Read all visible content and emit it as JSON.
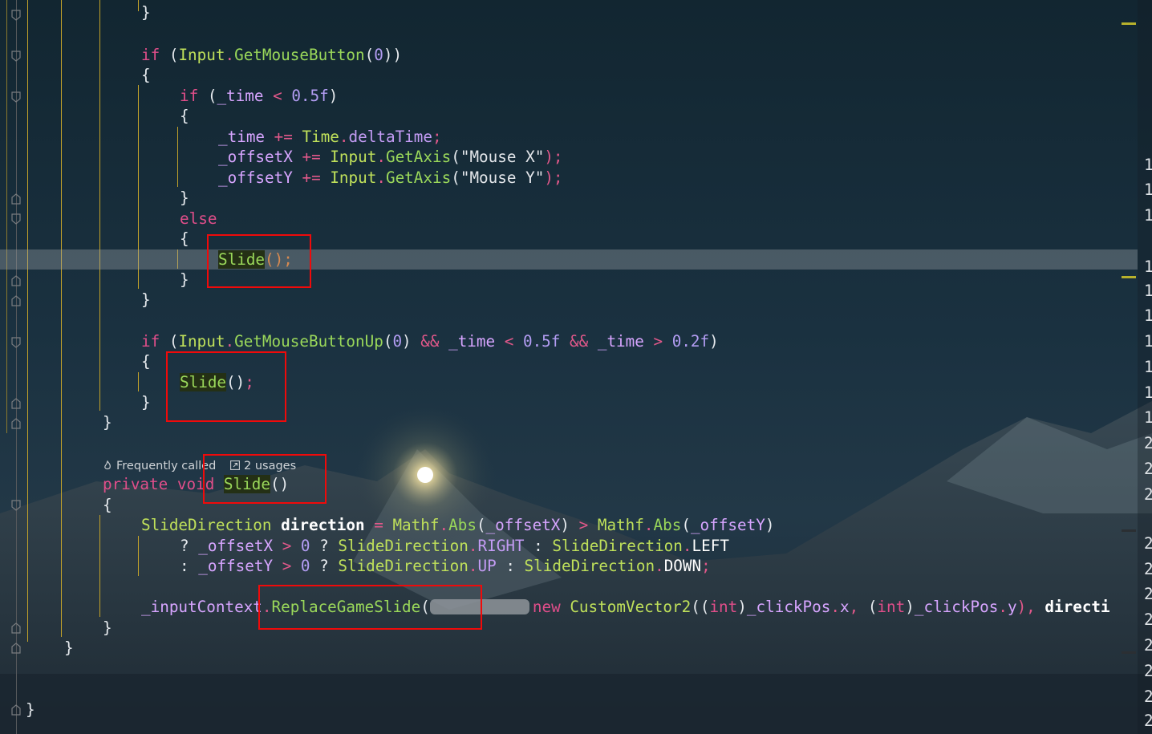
{
  "editor": {
    "lines": [
      {
        "t": 3,
        "segs": [
          [
            "}",
            "pn"
          ]
        ]
      },
      {
        "t": 56,
        "segs": [
          [
            "if ",
            "kw"
          ],
          [
            "(",
            "pn"
          ],
          [
            "Input",
            "ty"
          ],
          [
            ".",
            "op"
          ],
          [
            "GetMouseButton",
            "fn"
          ],
          [
            "(",
            "pn"
          ],
          [
            "0",
            "num"
          ],
          [
            "))",
            "pn"
          ]
        ]
      },
      {
        "t": 81,
        "segs": [
          [
            "{",
            "pn"
          ]
        ]
      },
      {
        "t": 107,
        "segs": [
          [
            "if ",
            "kw"
          ],
          [
            "(",
            "pn"
          ],
          [
            "_time",
            "fld"
          ],
          [
            " < ",
            "op"
          ],
          [
            "0.5f",
            "num"
          ],
          [
            ")",
            "pn"
          ]
        ]
      },
      {
        "t": 132,
        "segs": [
          [
            "{",
            "pn"
          ]
        ]
      },
      {
        "t": 158,
        "segs": [
          [
            "_time",
            "fld"
          ],
          [
            " += ",
            "op"
          ],
          [
            "Time",
            "ty"
          ],
          [
            ".",
            "op"
          ],
          [
            "deltaTime",
            "hf"
          ],
          [
            ";",
            "semi"
          ]
        ]
      },
      {
        "t": 183,
        "segs": [
          [
            "_offsetX",
            "fld"
          ],
          [
            " += ",
            "op"
          ],
          [
            "Input",
            "ty"
          ],
          [
            ".",
            "op"
          ],
          [
            "GetAxis",
            "fn"
          ],
          [
            "(",
            "pn"
          ],
          [
            "\"Mouse X\"",
            "str"
          ],
          [
            ");",
            "semi"
          ]
        ]
      },
      {
        "t": 209,
        "segs": [
          [
            "_offsetY",
            "fld"
          ],
          [
            " += ",
            "op"
          ],
          [
            "Input",
            "ty"
          ],
          [
            ".",
            "op"
          ],
          [
            "GetAxis",
            "fn"
          ],
          [
            "(",
            "pn"
          ],
          [
            "\"Mouse Y\"",
            "str"
          ],
          [
            ");",
            "semi"
          ]
        ]
      },
      {
        "t": 234,
        "segs": [
          [
            "}",
            "pn"
          ]
        ]
      },
      {
        "t": 260,
        "segs": [
          [
            "else",
            "kw"
          ]
        ]
      },
      {
        "t": 285,
        "segs": [
          [
            "{",
            "pn"
          ]
        ]
      },
      {
        "t": 311,
        "segs": [
          [
            "Slide",
            "fn usage-hl"
          ],
          [
            "()",
            "o"
          ],
          [
            ";",
            "o"
          ]
        ]
      },
      {
        "t": 336,
        "segs": [
          [
            "}",
            "pn"
          ]
        ]
      },
      {
        "t": 361,
        "segs": [
          [
            "}",
            "pn"
          ]
        ]
      },
      {
        "t": 413,
        "segs": [
          [
            "if ",
            "kw"
          ],
          [
            "(",
            "pn"
          ],
          [
            "Input",
            "ty"
          ],
          [
            ".",
            "op"
          ],
          [
            "GetMouseButtonUp",
            "fn"
          ],
          [
            "(",
            "pn"
          ],
          [
            "0",
            "num"
          ],
          [
            ") ",
            "pn"
          ],
          [
            "&& ",
            "op"
          ],
          [
            "_time",
            "fld"
          ],
          [
            " < ",
            "op"
          ],
          [
            "0.5f",
            "num"
          ],
          [
            " && ",
            "op"
          ],
          [
            "_time",
            "fld"
          ],
          [
            " > ",
            "op"
          ],
          [
            "0.2f",
            "num"
          ],
          [
            ")",
            "pn"
          ]
        ]
      },
      {
        "t": 438,
        "segs": [
          [
            "{",
            "pn"
          ]
        ]
      },
      {
        "t": 464,
        "segs": [
          [
            "Slide",
            "fn usage-hl"
          ],
          [
            "()",
            "pn"
          ],
          [
            ";",
            "semi"
          ]
        ]
      },
      {
        "t": 489,
        "segs": [
          [
            "}",
            "pn"
          ]
        ]
      },
      {
        "t": 514,
        "segs": [
          [
            "}",
            "pn"
          ]
        ]
      },
      {
        "t": 591,
        "segs": [
          [
            "private ",
            "kw"
          ],
          [
            "void ",
            "kw"
          ],
          [
            "Slide",
            "fn usage-hl"
          ],
          [
            "()",
            "pn"
          ]
        ]
      },
      {
        "t": 617,
        "segs": [
          [
            "{",
            "pn"
          ]
        ]
      },
      {
        "t": 642,
        "segs": [
          [
            "SlideDirection",
            "ty"
          ],
          [
            " ",
            "pn"
          ],
          [
            "direction",
            "lc"
          ],
          [
            " = ",
            "op"
          ],
          [
            "Mathf",
            "ty"
          ],
          [
            ".",
            "op"
          ],
          [
            "Abs",
            "fn"
          ],
          [
            "(",
            "pn"
          ],
          [
            "_offsetX",
            "fld"
          ],
          [
            ") ",
            "pn"
          ],
          [
            "> ",
            "op"
          ],
          [
            "Mathf",
            "ty"
          ],
          [
            ".",
            "op"
          ],
          [
            "Abs",
            "fn"
          ],
          [
            "(",
            "pn"
          ],
          [
            "_offsetY",
            "fld"
          ],
          [
            ")",
            "pn"
          ]
        ]
      },
      {
        "t": 668,
        "segs": [
          [
            "? ",
            "pn"
          ],
          [
            "_offsetX",
            "fld"
          ],
          [
            " > ",
            "op"
          ],
          [
            "0",
            "num"
          ],
          [
            " ? ",
            "pn"
          ],
          [
            "SlideDirection",
            "ty"
          ],
          [
            ".",
            "op"
          ],
          [
            "RIGHT",
            "hf"
          ],
          [
            " : ",
            "pn"
          ],
          [
            "SlideDirection",
            "ty"
          ],
          [
            ".",
            "op"
          ],
          [
            "LEFT",
            "pl"
          ]
        ]
      },
      {
        "t": 693,
        "segs": [
          [
            ": ",
            "pn"
          ],
          [
            "_offsetY",
            "fld"
          ],
          [
            " > ",
            "op"
          ],
          [
            "0",
            "num"
          ],
          [
            " ? ",
            "pn"
          ],
          [
            "SlideDirection",
            "ty"
          ],
          [
            ".",
            "op"
          ],
          [
            "UP",
            "hf"
          ],
          [
            " : ",
            "pn"
          ],
          [
            "SlideDirection",
            "ty"
          ],
          [
            ".",
            "op"
          ],
          [
            "DOWN",
            "pl"
          ],
          [
            ";",
            "semi"
          ]
        ]
      },
      {
        "t": 744,
        "segs": [
          [
            "_inputContext",
            "fld"
          ],
          [
            ".",
            "op"
          ],
          [
            "ReplaceGameSlide",
            "fn"
          ],
          [
            "(",
            "pn"
          ],
          [
            "BLUR",
            "blur"
          ],
          [
            "new ",
            "kw"
          ],
          [
            "CustomVector2",
            "ty"
          ],
          [
            "((",
            "pn"
          ],
          [
            "int",
            "kw"
          ],
          [
            ")",
            "pn"
          ],
          [
            "_clickPos",
            "fld"
          ],
          [
            ".",
            "op"
          ],
          [
            "x",
            "fld"
          ],
          [
            ", ",
            "op"
          ],
          [
            "(",
            "pn"
          ],
          [
            "int",
            "kw"
          ],
          [
            ")",
            "pn"
          ],
          [
            "_clickPos",
            "fld"
          ],
          [
            ".",
            "op"
          ],
          [
            "y",
            "fld"
          ],
          [
            "), ",
            "op"
          ],
          [
            "directi",
            "lc"
          ]
        ]
      },
      {
        "t": 770,
        "segs": [
          [
            "}",
            "pn"
          ]
        ]
      },
      {
        "t": 795,
        "segs": [
          [
            "}",
            "pn"
          ]
        ]
      },
      {
        "t": 872,
        "segs": [
          [
            "}",
            "pn"
          ]
        ]
      }
    ],
    "inlay_hint": {
      "frequently_called": "Frequently called",
      "usages": "2 usages"
    },
    "gutter_line_numbers": [
      "1",
      "1",
      "1",
      "1",
      "1",
      "1",
      "1",
      "1",
      "1",
      "1",
      "2",
      "2",
      "2",
      "2",
      "2",
      "2",
      "2",
      "2",
      "2",
      "2",
      "2"
    ]
  },
  "colors": {
    "annotation_box": "#f00a0a",
    "keyword": "#e14e8a",
    "type": "#bfe05a",
    "field": "#d7a5ff",
    "number": "#b39df3",
    "scroll_marker": "#b7b12c"
  },
  "icons": [
    "fold-collapse-icon",
    "flame-icon",
    "external-link-icon"
  ]
}
